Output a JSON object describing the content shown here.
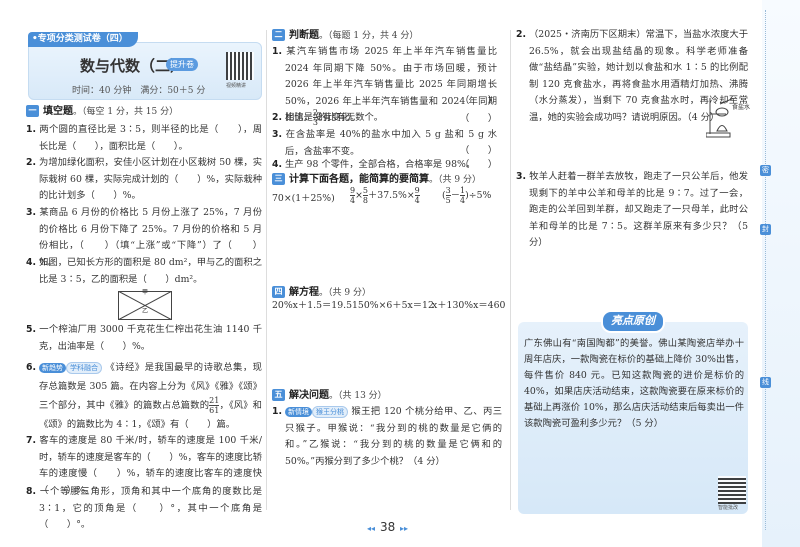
{
  "header": {
    "series": "•专项分类测试卷（四）",
    "title": "数与代数（二）",
    "badge": "提升卷",
    "meta": "时间：40 分钟　满分：50＋5 分",
    "qr_caption": "视频精讲"
  },
  "sec1": {
    "num": "一",
    "title": "填空题",
    "pts": "。（每空 1 分，共 15 分）",
    "q1": "两个圆的直径比是 3∶5，则半径的比是（　　），周长比是（　　），面积比是（　　）。",
    "q2": "为增加绿化面积，安佳小区计划在小区栽树 50 棵，实际栽树 60 棵，实际完成计划的（　　）%，实际栽种的比计划多（　　）%。",
    "q3": "某商品 6 月份的价格比 5 月份上涨了 25%，7 月份的价格比 6 月份下降了 25%。7 月份的价格和 5 月份相比，（　　）（填“上涨”或“下降”）了（　　）%。",
    "q4": "如图，已知长方形的面积是 80 dm²，甲与乙的面积之比是 3∶5，乙的面积是（　　）dm²。",
    "fig_jia": "甲",
    "fig_yi": "乙",
    "q5": "一个榨油厂用 3000 千克花生仁榨出花生油 1140 千克，出油率是（　　）%。",
    "q6_tag1": "新趋势",
    "q6_tag2": "学科融合",
    "q6a": "《诗经》是我国最早的诗歌总集，现存总篇数是 305 篇。在内容上分为《风》《雅》《颂》三个部分，其中《雅》的篇数占总篇数的",
    "q6_num": "21",
    "q6_den": "61",
    "q6b": "，《风》和《颂》的篇数比为 4∶1，《颂》有（　　）篇。",
    "q7": "客车的速度是 80 千米/时，轿车的速度是 100 千米/时，轿车的速度是客车的（　　）%，客车的速度比轿车的速度慢（　　）%，轿车的速度比客车的速度快（　　）%。",
    "q8": "一个等腰三角形，顶角和其中一个底角的度数比是 3∶1，它的顶角是（　　）°，其中一个底角是（　　）°。"
  },
  "sec2": {
    "num": "二",
    "title": "判断题",
    "pts": "。（每题 1 分，共 4 分）",
    "q1": "某汽车销售市场 2025 年上半年汽车销售量比 2024 年同期下降 50%。由于市场回暖，预计 2026 年上半年汽车销售量比 2025 年同期增长 50%，2026 年上半年汽车销售量和 2024 年同期相比，没有变化。",
    "q2a": "比值是",
    "q2_num": "2",
    "q2_den": "3",
    "q2b": "的比有无数个。",
    "q3": "在含盐率是 40%的盐水中加入 5 g 盐和 5 g 水后，含盐率不变。",
    "q4": "生产 98 个零件，全部合格，合格率是 98%。",
    "paren": "（　　）"
  },
  "sec3": {
    "num": "三",
    "title": "计算下面各题，能简算的要简算",
    "pts": "。（共 9 分）",
    "e1": "70×(1＋25%)",
    "e2a": "9",
    "e2b": "4",
    "e2c": "×",
    "e2d": "5",
    "e2e": "8",
    "e2f": "＋37.5%×",
    "e3a": "3",
    "e3b": "5",
    "e3c": "－",
    "e3d": "1",
    "e3e": "4",
    "e3f": "÷5%"
  },
  "sec4": {
    "num": "四",
    "title": "解方程",
    "pts": "。（共 9 分）",
    "e1": "20%x＋1.5＝19.5",
    "e2": "150%×6＋5x＝12",
    "e3": "x＋130%x＝460"
  },
  "sec5": {
    "num": "五",
    "title": "解决问题",
    "pts": "。（共 13 分）",
    "q1_tag1": "新情境",
    "q1_tag2": "猴王分桃",
    "q1": "猴王把 120 个桃分给甲、乙、丙三只猴子。甲猴说：“我分到的桃的数量是它俩的和。”乙猴说：“我分到的桃的数量是它俩和的 50%。”丙猴分到了多少个桃？（4 分）",
    "q2": "（2025・济南历下区期末）常温下，当盐水浓度大于 26.5%，就会出现盐结晶的现象。科学老师准备做“盐结晶”实验，她计划以食盐和水 1∶5 的比例配制 120 克食盐水，再将食盐水用酒精灯加热、沸腾（水分蒸发），当剩下 70 克食盐水时，再冷却至常温，她的实验会成功吗？请说明原因。（4 分）",
    "fig_label": "食盐水",
    "q3": "牧羊人赶着一群羊去放牧，跑走了一只公羊后，他发现剩下的羊中公羊和母羊的比是 9∶7。过了一会，跑走的公羊回到羊群，却又跑走了一只母羊，此时公羊和母羊的比是 7∶5。这群羊原来有多少只？（5 分）"
  },
  "highlight": {
    "title": "亮点原创",
    "text": "广东佛山有“南国陶都”的美誉。佛山某陶瓷店举办十周年店庆，一款陶瓷在标价的基础上降价 30%出售，每件售价 840 元。已知这款陶瓷的进价是标价的 40%，如果店庆活动结束，这款陶瓷要在原来标价的基础上再涨价 10%，那么店庆活动结束后每卖出一件该款陶瓷可盈利多少元？（5 分）",
    "qr_caption": "智能批改"
  },
  "footer": {
    "page": "38"
  },
  "strip": {
    "m1": "密",
    "m2": "封",
    "m3": "线"
  },
  "colors": {
    "accent": "#4a8fd8",
    "panel": "#e4f0fb"
  }
}
